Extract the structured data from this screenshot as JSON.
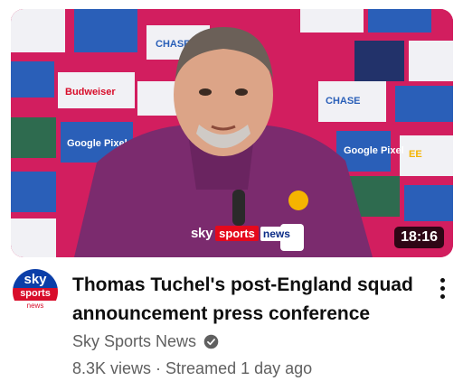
{
  "video": {
    "duration": "18:16",
    "title": "Thomas Tuchel's post-England squad announcement press conference",
    "channel_name": "Sky Sports News",
    "views": "8.3K views",
    "separator": "·",
    "published": "Streamed 1 day ago"
  },
  "thumbnail": {
    "watermark_sky": "sky",
    "watermark_sports": "sports",
    "watermark_news": "news",
    "backdrop_logos": [
      "CHASE",
      "Google Pixel",
      "CHASE",
      "Google Pixel",
      "EE",
      "Budweiser"
    ],
    "colors": {
      "backdrop": "#d21e5f",
      "jacket": "#7b2b6e",
      "board_white": "#f1f1f5",
      "board_blue": "#2a5fb8"
    }
  },
  "channel_avatar": {
    "line1": "sky",
    "line2": "sports",
    "line3": "news",
    "colors": {
      "blue": "#0b3ea8",
      "red": "#d80d2a"
    }
  },
  "icons": {
    "verified": "verified-check-icon",
    "more": "more-vertical-icon"
  }
}
